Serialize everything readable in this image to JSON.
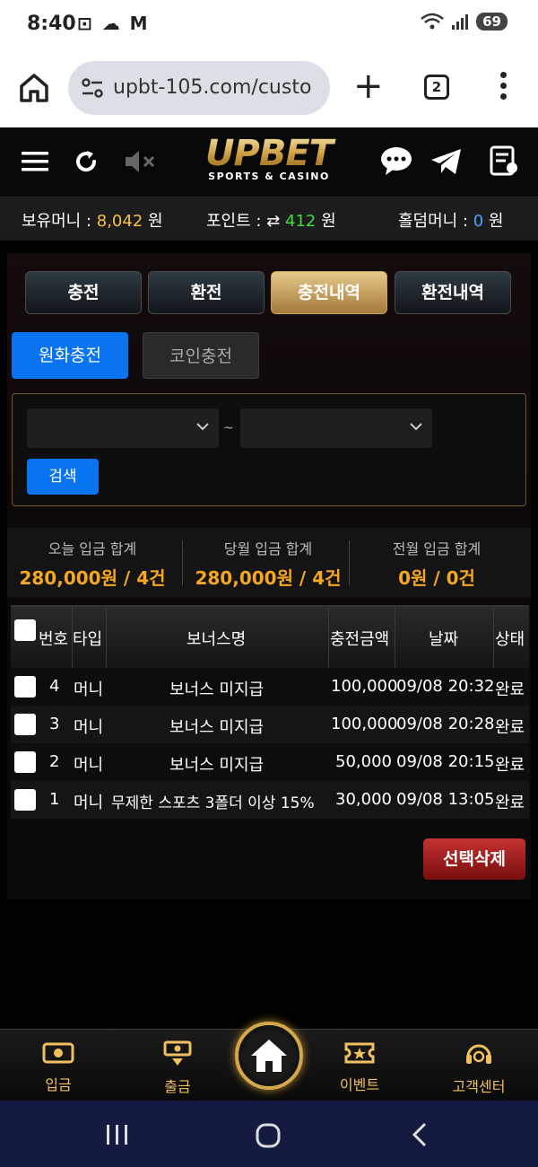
{
  "status_bar": {
    "time": "8:40",
    "icons": "⊡ ☁ M",
    "battery": "69"
  },
  "browser": {
    "url": "upbt-105.com/custo",
    "tab_count": "2"
  },
  "header": {
    "logo_text": "UPBET",
    "logo_sub": "SPORTS & CASINO"
  },
  "money": {
    "balance_label": "보유머니 : ",
    "balance_value": "8,042",
    "balance_unit": " 원",
    "point_label": "포인트 : ",
    "point_value": "412",
    "point_unit": " 원",
    "holdem_label": "홀덤머니 : ",
    "holdem_value": "0",
    "holdem_unit": " 원"
  },
  "tabs": [
    {
      "label": "충전"
    },
    {
      "label": "환전"
    },
    {
      "label": "충전내역",
      "active": true
    },
    {
      "label": "환전내역"
    }
  ],
  "subtabs": {
    "krw": "원화충전",
    "coin": "코인충전"
  },
  "search": {
    "tilde": "~",
    "button": "검색"
  },
  "sums": [
    {
      "label": "오늘 입금 합계",
      "value": "280,000원 / 4건"
    },
    {
      "label": "당월 입금 합계",
      "value": "280,000원 / 4건"
    },
    {
      "label": "전월 입금 합계",
      "value": "0원 / 0건"
    }
  ],
  "table": {
    "headers": [
      "번호",
      "타입",
      "보너스명",
      "충전금액",
      "날짜",
      "상태"
    ],
    "rows": [
      {
        "no": "4",
        "type": "머니",
        "bonus": "보너스 미지급",
        "amount": "100,000",
        "date": "09/08 20:32",
        "status": "완료"
      },
      {
        "no": "3",
        "type": "머니",
        "bonus": "보너스 미지급",
        "amount": "100,000",
        "date": "09/08 20:28",
        "status": "완료"
      },
      {
        "no": "2",
        "type": "머니",
        "bonus": "보너스 미지급",
        "amount": "50,000",
        "date": "09/08 20:15",
        "status": "완료"
      },
      {
        "no": "1",
        "type": "머니",
        "bonus": "무제한 스포츠 3폴더 이상 15%",
        "amount": "30,000",
        "date": "09/08 13:05",
        "status": "완료"
      }
    ]
  },
  "delete_button": "선택삭제",
  "bottom_nav": {
    "deposit": "입금",
    "withdraw": "출금",
    "event": "이벤트",
    "support": "고객센터"
  }
}
